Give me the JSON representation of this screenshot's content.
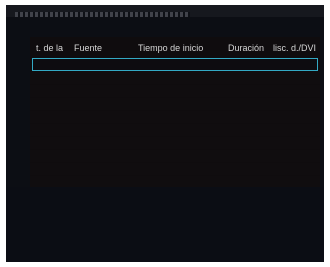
{
  "schedule_table": {
    "columns": [
      {
        "label": "t. de la"
      },
      {
        "label": "Fuente"
      },
      {
        "label": "Tiempo de inicio"
      },
      {
        "label": "Duración"
      },
      {
        "label": "lisc. d./DVI"
      }
    ],
    "selected_row": 0
  },
  "colors": {
    "selection_border": "#33a9c4",
    "header_text": "#d6d6d6",
    "panel_background": "#0f0c0e",
    "screen_background": "#0c0e14"
  }
}
